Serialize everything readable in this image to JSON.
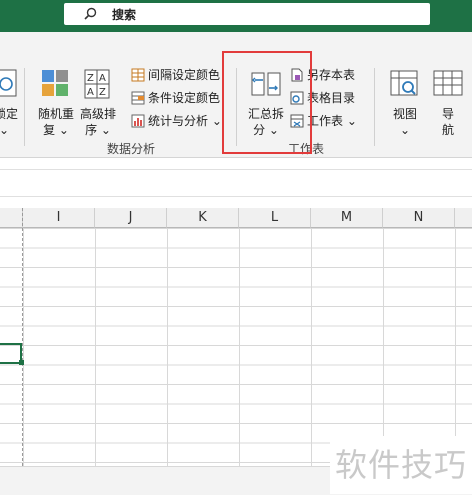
{
  "search": {
    "placeholder": "搜索"
  },
  "ribbon": {
    "left_cut_label_1": "锁定",
    "left_cut_label_2": "⌄",
    "random_repeat": {
      "line1": "随机重",
      "line2": "复 ⌄"
    },
    "advanced_sort": {
      "line1": "高级排",
      "line2": "序 ⌄"
    },
    "interval_color": "间隔设定颜色",
    "condition_color": "条件设定颜色",
    "stats_analysis": "统计与分析 ⌄",
    "group_data_analysis": "数据分析",
    "summary_split": {
      "line1": "汇总拆",
      "line2": "分 ⌄"
    },
    "save_sheet": "另存本表",
    "sheet_dir": "表格目录",
    "worksheet": "工作表 ⌄",
    "group_worksheet": "工作表",
    "view": {
      "line1": "视图",
      "line2": "⌄"
    },
    "nav": {
      "line1": "导",
      "line2": "航"
    }
  },
  "columns": [
    "I",
    "J",
    "K",
    "L",
    "M",
    "N"
  ],
  "watermark": "软件技巧",
  "colors": {
    "brand": "#1e7145",
    "highlight": "#e23b3b"
  }
}
